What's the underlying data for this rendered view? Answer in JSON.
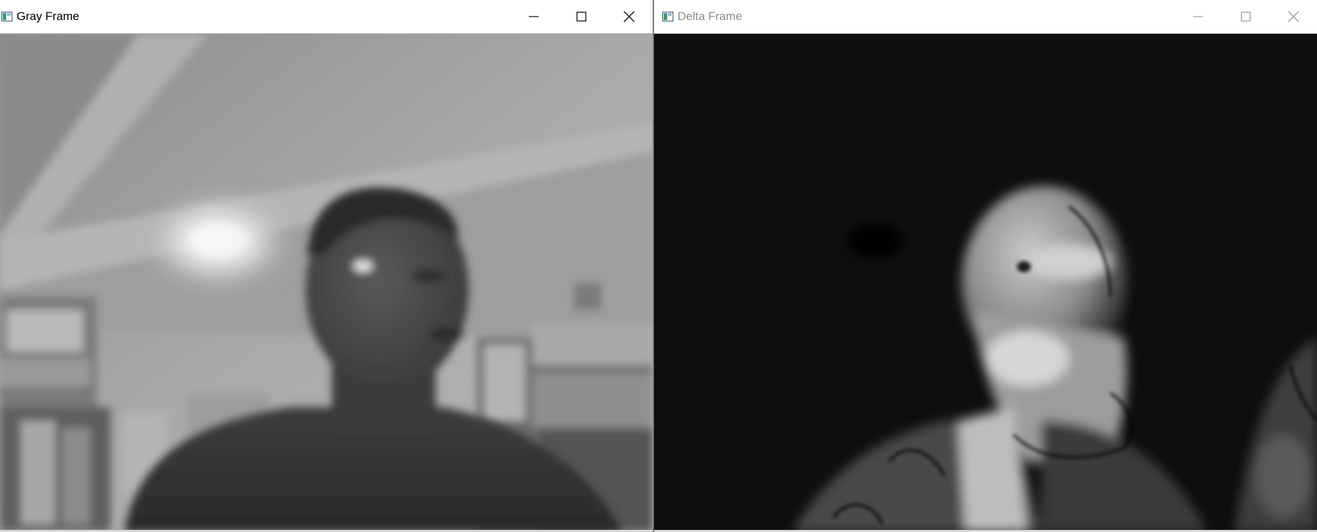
{
  "windows": [
    {
      "title": "Gray Frame",
      "state": "active",
      "controls": [
        "minimize-icon",
        "maximize-icon",
        "close-icon"
      ]
    },
    {
      "title": "Delta Frame",
      "state": "inactive",
      "controls": [
        "minimize-icon",
        "maximize-icon",
        "close-icon"
      ]
    }
  ],
  "colors": {
    "active_glyph": "#000000",
    "inactive_glyph": "#9a9a9a",
    "icon_green": "#3a9a6a",
    "icon_frame": "#2f4f6f"
  }
}
